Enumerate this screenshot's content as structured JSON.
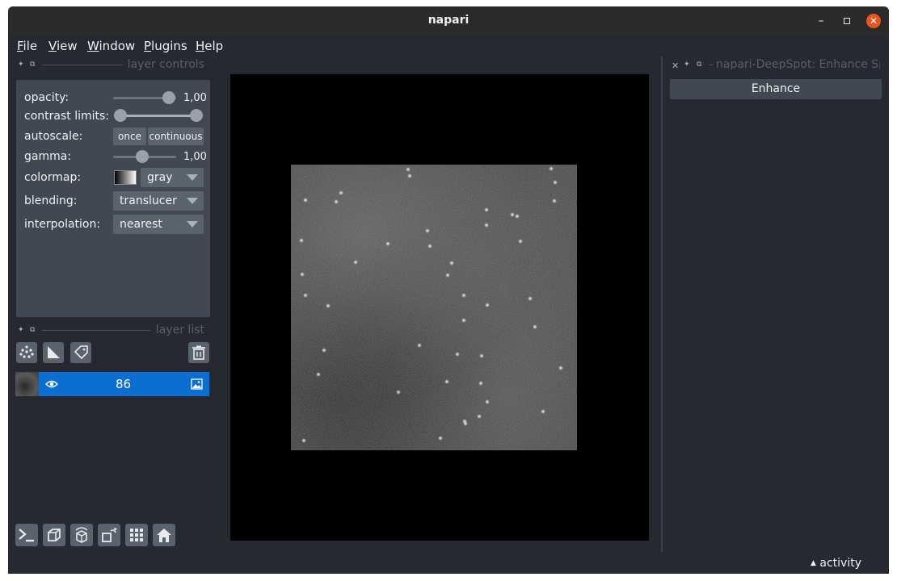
{
  "window": {
    "title": "napari"
  },
  "menu": {
    "file": "File",
    "view": "View",
    "window": "Window",
    "plugins": "Plugins",
    "help": "Help"
  },
  "layer_controls": {
    "header": "layer controls",
    "opacity_label": "opacity:",
    "opacity_value": "1,00",
    "opacity_level": 1.0,
    "contrast_label": "contrast limits:",
    "autoscale_label": "autoscale:",
    "autoscale_once": "once",
    "autoscale_continuous": "continuous",
    "gamma_label": "gamma:",
    "gamma_value": "1,00",
    "colormap_label": "colormap:",
    "colormap_value": "gray",
    "blending_label": "blending:",
    "blending_value": "translucer",
    "interpolation_label": "interpolation:",
    "interpolation_value": "nearest"
  },
  "layer_list": {
    "header": "layer list",
    "layers": [
      {
        "name": "86",
        "visible": true,
        "type": "image"
      }
    ]
  },
  "plugin": {
    "header": "napari-DeepSpot: Enhance Spo",
    "enhance_label": "Enhance"
  },
  "status": {
    "activity_label": "activity"
  },
  "colors": {
    "accent": "#0a6fd1",
    "background": "#262930",
    "panel": "#414851",
    "close": "#e95420"
  }
}
